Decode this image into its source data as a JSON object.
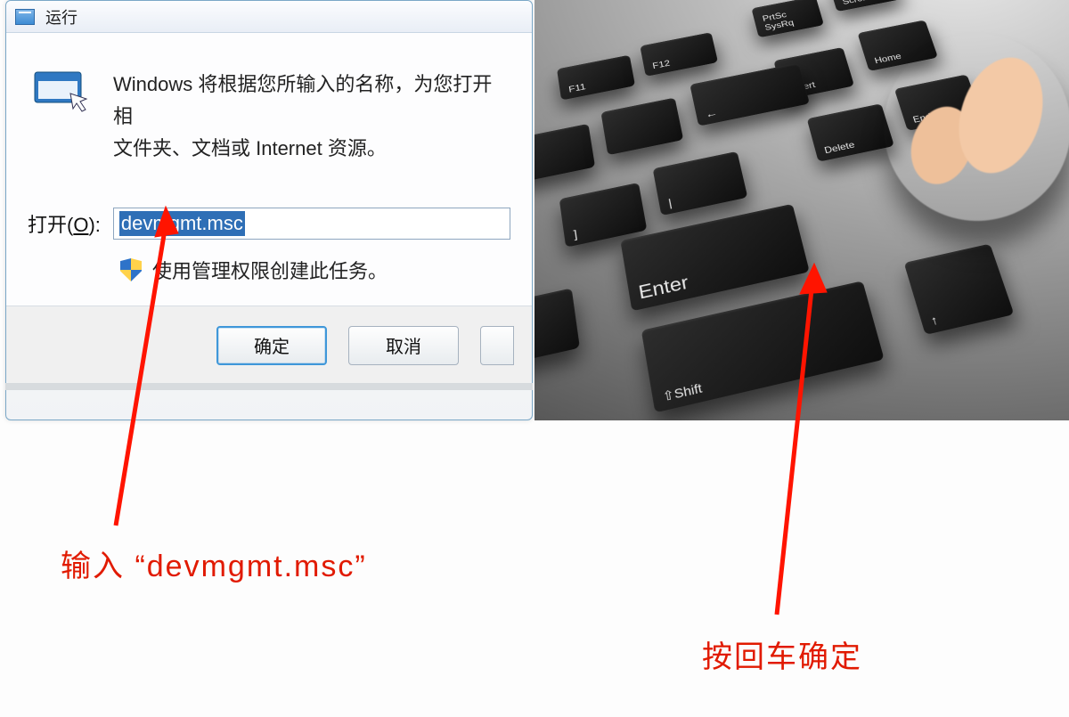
{
  "dialog": {
    "title": "运行",
    "description": "Windows 将根据您所输入的名称，为您打开相\n文件夹、文档或 Internet 资源。",
    "open_label_pre": "打开(",
    "open_label_mn": "O",
    "open_label_post": "):",
    "input_value": "devmgmt.msc",
    "admin_note": "使用管理权限创建此任务。",
    "ok_label": "确定",
    "cancel_label": "取消"
  },
  "keyboard_keys": {
    "f11": "F11",
    "f12": "F12",
    "prtsc": "PrtSc SysRq",
    "scroll": "Scroll Lock",
    "insert": "Insert",
    "home": "Home",
    "backspace": "←",
    "bracket_right": "]",
    "pipe": "|",
    "delete": "Delete",
    "end": "End",
    "enter": "Enter",
    "shift": "⇧Shift",
    "up": "↑"
  },
  "annotations": {
    "input_caption": "输入 “devmgmt.msc”",
    "enter_caption": "按回车确定"
  }
}
